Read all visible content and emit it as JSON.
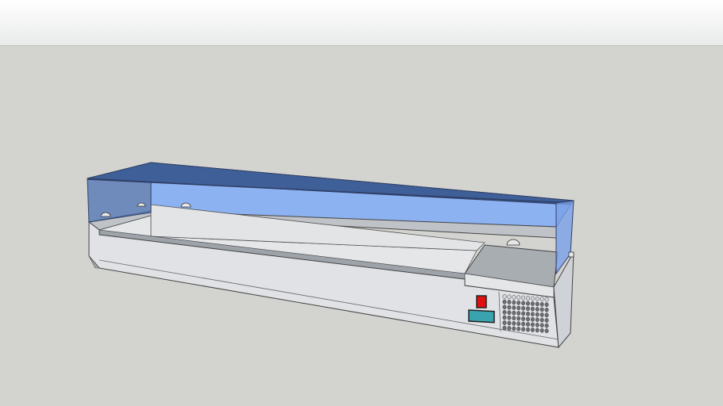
{
  "scene": {
    "model": "refrigerated-topping-display-case",
    "colors": {
      "background": "#d3d4cf",
      "glass_light": "#8db2f2",
      "glass_dark": "#3f5f98",
      "steel": "#dfe1e4",
      "steel_shade": "#c9ccd1",
      "switch": "#e01010",
      "display": "#3aa3b0"
    }
  }
}
